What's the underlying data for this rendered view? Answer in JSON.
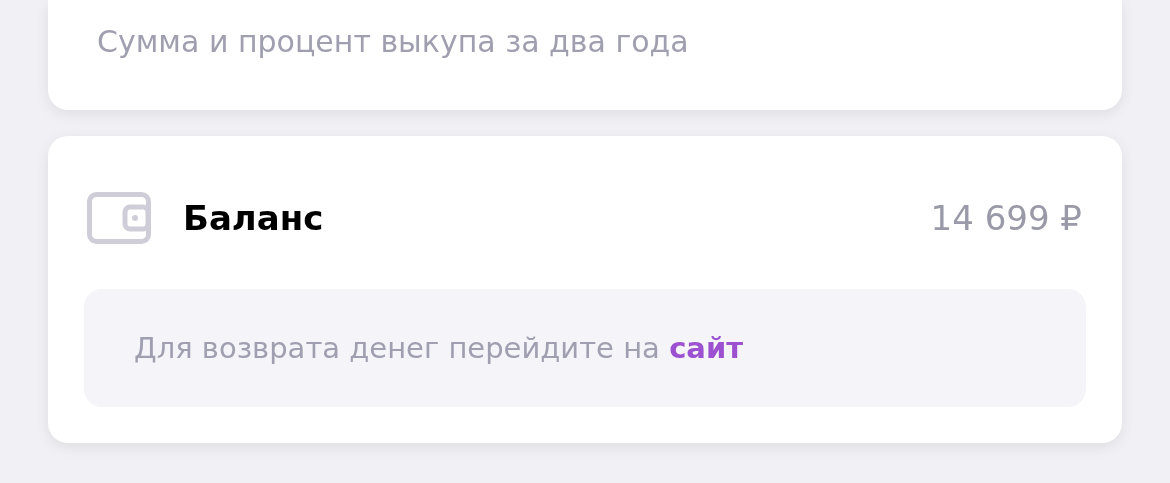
{
  "summary_card": {
    "caption": "Сумма и процент выкупа за два года"
  },
  "balance_card": {
    "title": "Баланс",
    "amount": "14 699 ₽",
    "refund_note": {
      "text": "Для возврата денег перейдите на",
      "link": "сайт"
    }
  }
}
